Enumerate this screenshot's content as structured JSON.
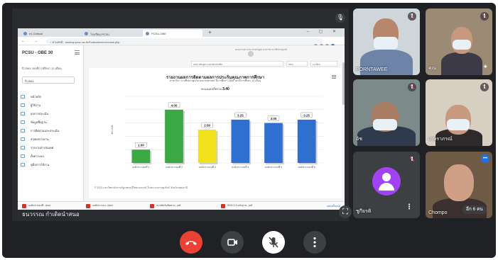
{
  "presentation": {
    "presenter_name": "ธนวรรณ กำเดิดนำสนอ",
    "browser": {
      "tabs": [
        "e1.Outlook",
        "โรงเรียน PCSU",
        "PCSU-OBE",
        "+"
      ],
      "url": "‹  ยานสดมี - backup.pcsu.ac.th/Evaluation/overview.php"
    },
    "sidebar": {
      "title": "PCSU - OBE 30",
      "subtitle": "ปี 2564 รอบปีการศึกษา 12 เดือน",
      "select_value": "ปี 2564",
      "items": [
        "หน้าหลัก",
        "ผู้ใช้งาน",
        "ผลการประเมิน",
        "ข้อมูลพื้นฐาน",
        "การติดตามและประเมิน",
        "สรุปผลรายงาน",
        "รายงานสารสนเทศ",
        "ตั้งค่าระบบ",
        "คู่มือการใช้งาน"
      ]
    },
    "content": {
      "top_info": "คณะกรรมการประจำหลักสูตร สาขาวิชาการศึกษาปฐมวัย",
      "filter_left": "2550 หลักสูตร ครุศาสตรบัณฑิต",
      "filter_year": "2564",
      "filter_period": "12 เดือน",
      "chart_title": "รายงานผลการติดตามผลการประกันคุณภาพการศึกษา",
      "chart_subtitle": "สาขาวิชา การศึกษาปฐมวัย คณะครุศาสตร์ ปีการศึกษา 2564 รอบปีการศึกษา 12 เดือน",
      "score_label": "คะแนนเฉลี่ยรวม",
      "score_value": "3.40",
      "footer": "© 2021 มหาวิทยาลัยราชภัฏเพชรบุรีวิทยาลงกรณ์ ในพระบรมราชูปถัมภ์ จังหวัดปทุมธานี"
    },
    "downloads": [
      "องค์ประกอบที่...docx",
      "องค์ประกอบ...docx",
      "แบบฟอร์มติดตาม...pdf",
      "SDG 2.3 หลักฐาน...pdf"
    ],
    "downloads_show_all": "แสดงทั้งหมด"
  },
  "chart_data": {
    "type": "bar",
    "categories": [
      "องค์ประกอบที่ 1",
      "องค์ประกอบที่ 2",
      "องค์ประกอบที่ 3",
      "องค์ประกอบที่ 4",
      "องค์ประกอบที่ 5",
      "องค์ประกอบที่ 6"
    ],
    "values": [
      1.0,
      4.0,
      2.5,
      3.25,
      3.0,
      3.25
    ],
    "value_labels": [
      "1.00",
      "4.00",
      "2.50",
      "3.25",
      "3.00",
      "3.25"
    ],
    "bar_colors": [
      "#3aa843",
      "#3aa843",
      "#f2e01c",
      "#2f6fd0",
      "#2f6fd0",
      "#2f6fd0"
    ],
    "ylabel": "คะแนน",
    "ylim": [
      0,
      5
    ],
    "grid": true
  },
  "participants": [
    {
      "name": "PORNTAWEE",
      "muted": true
    },
    {
      "name": "คุณ",
      "muted": true
    },
    {
      "name": "อิช",
      "muted": true
    },
    {
      "name": "เกษราภรณ์",
      "muted": true
    },
    {
      "name": "ชูกียรติ",
      "muted": true
    },
    {
      "name": "Chompo",
      "more": "อีก 6 คน"
    }
  ],
  "controls": {
    "end_call": "end-call",
    "camera": "camera",
    "mic": "mic-off",
    "more": "⋮"
  }
}
